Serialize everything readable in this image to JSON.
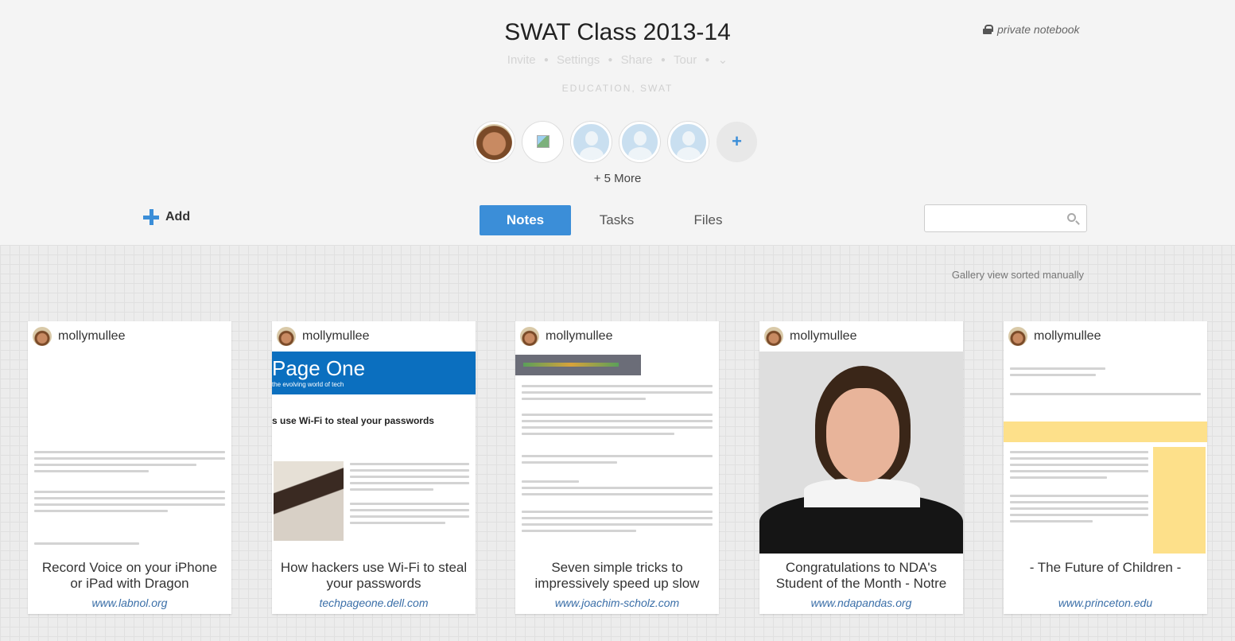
{
  "header": {
    "title": "SWAT Class 2013-14",
    "private_label": "private notebook",
    "actions": [
      "Invite",
      "Settings",
      "Share",
      "Tour"
    ],
    "tags": "EDUCATION, SWAT",
    "more_members": "+ 5 More",
    "add_label": "Add"
  },
  "tabs": {
    "notes": "Notes",
    "tasks": "Tasks",
    "files": "Files"
  },
  "search": {
    "placeholder": ""
  },
  "gallery": {
    "sort_label": "Gallery view sorted manually",
    "cards": [
      {
        "author": "mollymullee",
        "title": "Record Voice on your iPhone or iPad with Dragon",
        "url": "www.labnol.org"
      },
      {
        "author": "mollymullee",
        "title": "How hackers use Wi-Fi to steal your passwords",
        "url": "techpageone.dell.com",
        "thumb_banner": "Page One",
        "thumb_tagline": "the evolving world of tech",
        "thumb_heading": "s use Wi-Fi to steal your passwords"
      },
      {
        "author": "mollymullee",
        "title": "Seven simple tricks to impressively speed up slow",
        "url": "www.joachim-scholz.com"
      },
      {
        "author": "mollymullee",
        "title": "Congratulations to NDA's Student of the Month - Notre",
        "url": "www.ndapandas.org"
      },
      {
        "author": "mollymullee",
        "title": "- The Future of Children -",
        "url": "www.princeton.edu"
      }
    ]
  },
  "colors": {
    "accent": "#3b8ed8",
    "link": "#3b6fa8"
  }
}
